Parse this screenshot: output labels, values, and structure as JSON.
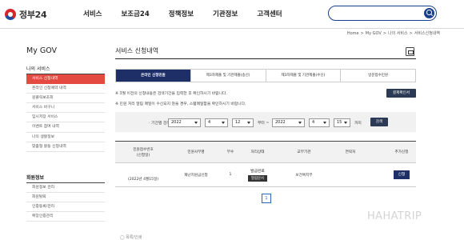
{
  "brand": {
    "name": "정부24"
  },
  "nav": [
    "서비스",
    "보조금24",
    "정책정보",
    "기관정보",
    "고객센터"
  ],
  "search": {
    "placeholder": ""
  },
  "breadcrumb": [
    "Home",
    ">",
    "My GOV",
    ">",
    "나의 서비스",
    ">",
    "서비스신청내역"
  ],
  "sidebar": {
    "title": "My GOV",
    "section1": {
      "label": "나의 서비스",
      "items": [
        "서비스 신청내역",
        "온라인 신청예약 내역",
        "원클릭보조회",
        "서비스 바구니",
        "임시저장 서비스",
        "이벤트 참여 내역",
        "나의 생활정보",
        "맞춤형 활동 신청내역"
      ]
    },
    "section2": {
      "label": "회원정보",
      "items": [
        "회원정보 관리",
        "회원탈퇴",
        "인증등록/관리",
        "확장인증관리"
      ]
    }
  },
  "main": {
    "title": "서비스 신청내역",
    "tabs": [
      "온라인 신청민원",
      "제3자제출 및 기관제출(송신)",
      "제3자제출 및 기관제출(수신)",
      "방문접수민원"
    ],
    "notice1": "※ 3월 이전의 신청내용은 검색기간을 입력한 후 확인하시기 바랍니다.",
    "notice2": "※ 민원 처리 알림 메일이 수신되지 않을 경우, 스팸메일함을 확인하시기 바랍니다.",
    "result_button": "결제확인서",
    "filter": {
      "period_label": "· 기간별 검색",
      "start": {
        "year": "2022",
        "month": "4",
        "day": "12"
      },
      "from_label": "부터 ~",
      "end": {
        "year": "2022",
        "month": "4",
        "day": "15"
      },
      "to_label": "까지",
      "search_button": "검색"
    },
    "table": {
      "headers": [
        "민원접수번호\n(신청일)",
        "민원사무명",
        "부수",
        "처리상태",
        "교부기관",
        "연락처",
        "추가신청"
      ],
      "rows": [
        {
          "date": "(2022년 4월15일)",
          "service": "재난지원금신청",
          "count": "1",
          "status": "발급완료",
          "doc_button": "열람문서",
          "agency": "보건복지부",
          "contact": "",
          "apply_button": "신청"
        }
      ]
    },
    "pagination": {
      "current": "1"
    }
  },
  "watermark": "HAHATRIP",
  "footer_text": "◯ 목록/인쇄"
}
